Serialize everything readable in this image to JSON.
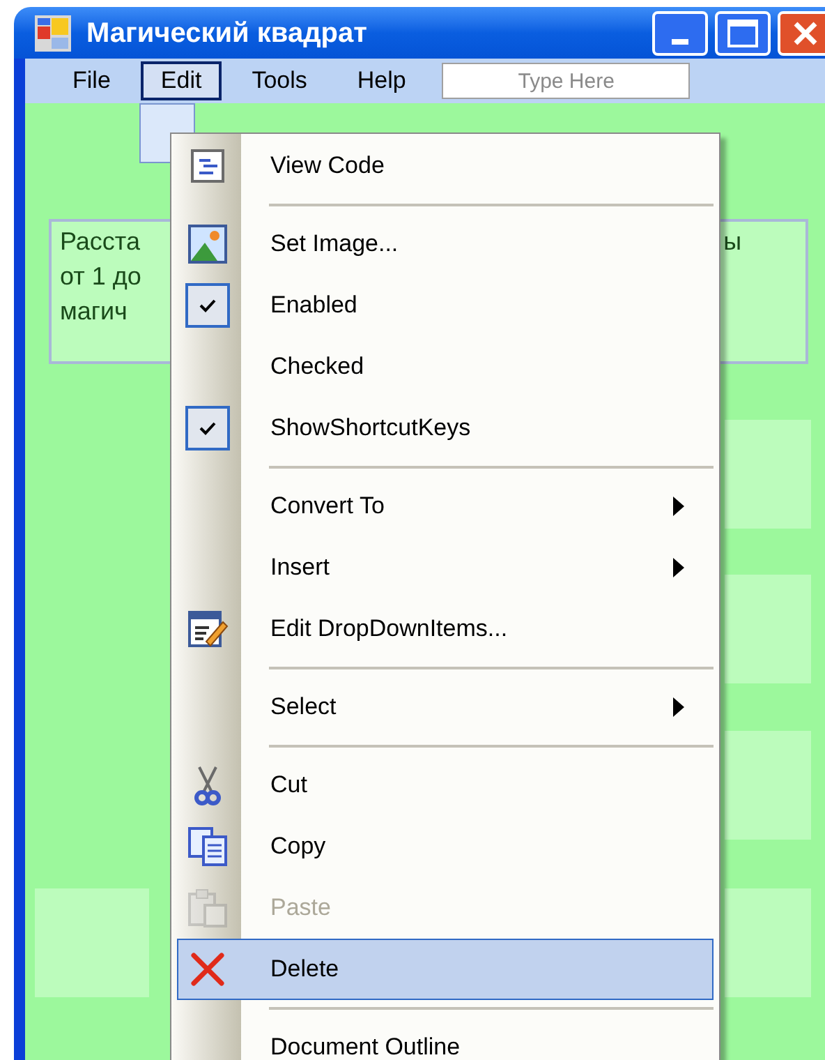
{
  "window": {
    "title": "Магический квадрат"
  },
  "menu_bar": {
    "items": [
      {
        "label": "File",
        "selected": false
      },
      {
        "label": "Edit",
        "selected": true
      },
      {
        "label": "Tools",
        "selected": false
      },
      {
        "label": "Help",
        "selected": false
      }
    ],
    "new_item": {
      "placeholder": "Type Here"
    }
  },
  "form": {
    "label_lines": [
      "Расста",
      "от 1 до",
      "магич"
    ],
    "label_right": "ы"
  },
  "context_menu": [
    {
      "kind": "item",
      "label": "View Code",
      "selected": false
    },
    {
      "kind": "separator"
    },
    {
      "kind": "item",
      "label": "Set Image...",
      "selected": false
    },
    {
      "kind": "check",
      "label": "Enabled",
      "checked": true,
      "selected": false
    },
    {
      "kind": "check",
      "label": "Checked",
      "checked": false,
      "selected": false
    },
    {
      "kind": "check",
      "label": "ShowShortcutKeys",
      "checked": true,
      "selected": false
    },
    {
      "kind": "separator"
    },
    {
      "kind": "item",
      "label": "Convert To",
      "submenu": true,
      "selected": false
    },
    {
      "kind": "item",
      "label": "Insert",
      "submenu": true,
      "selected": false
    },
    {
      "kind": "item",
      "label": "Edit DropDownItems...",
      "selected": false
    },
    {
      "kind": "separator"
    },
    {
      "kind": "item",
      "label": "Select",
      "submenu": true,
      "selected": false
    },
    {
      "kind": "separator"
    },
    {
      "kind": "item",
      "label": "Cut",
      "selected": false
    },
    {
      "kind": "item",
      "label": "Copy",
      "selected": false
    },
    {
      "kind": "item",
      "label": "Paste",
      "disabled": true,
      "selected": false
    },
    {
      "kind": "item",
      "label": "Delete",
      "selected": true
    },
    {
      "kind": "separator"
    },
    {
      "kind": "item",
      "label": "Document Outline",
      "selected": false
    }
  ]
}
